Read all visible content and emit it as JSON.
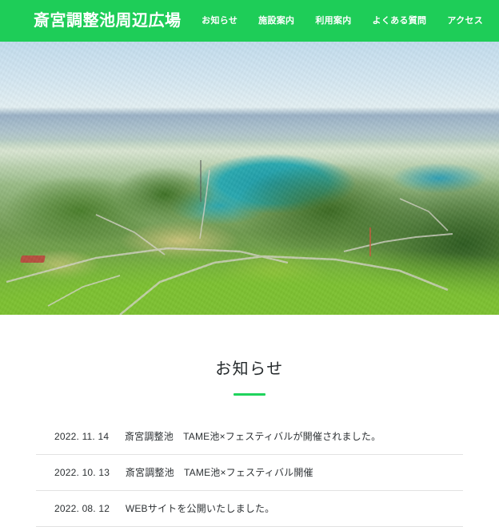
{
  "theme": {
    "brand_green": "#1ecd58",
    "accent_green": "#1fd35c",
    "text_dark": "#2c3033",
    "divider": "#e2e2e2"
  },
  "header": {
    "brand": "斎宮調整池周辺広場",
    "nav": [
      {
        "label": "お知らせ",
        "name": "nav-news"
      },
      {
        "label": "施設案内",
        "name": "nav-facilities"
      },
      {
        "label": "利用案内",
        "name": "nav-usage"
      },
      {
        "label": "よくある質問",
        "name": "nav-faq"
      },
      {
        "label": "アクセス",
        "name": "nav-access"
      }
    ]
  },
  "hero": {
    "image_alt": "斎宮調整池の空撮写真 — 調整池とその周辺の丘陵・公園",
    "slides_total": 3,
    "active_slide": 1,
    "dots": [
      {
        "active": true
      },
      {
        "active": false
      },
      {
        "active": false
      }
    ]
  },
  "news": {
    "title": "お知らせ",
    "items": [
      {
        "date": "2022. 11. 14",
        "text": "斎宮調整池　TAME池×フェスティバルが開催されました。"
      },
      {
        "date": "2022. 10. 13",
        "text": "斎宮調整池　TAME池×フェスティバル開催"
      },
      {
        "date": "2022. 08. 12",
        "text": "WEBサイトを公開いたしました。"
      }
    ]
  }
}
